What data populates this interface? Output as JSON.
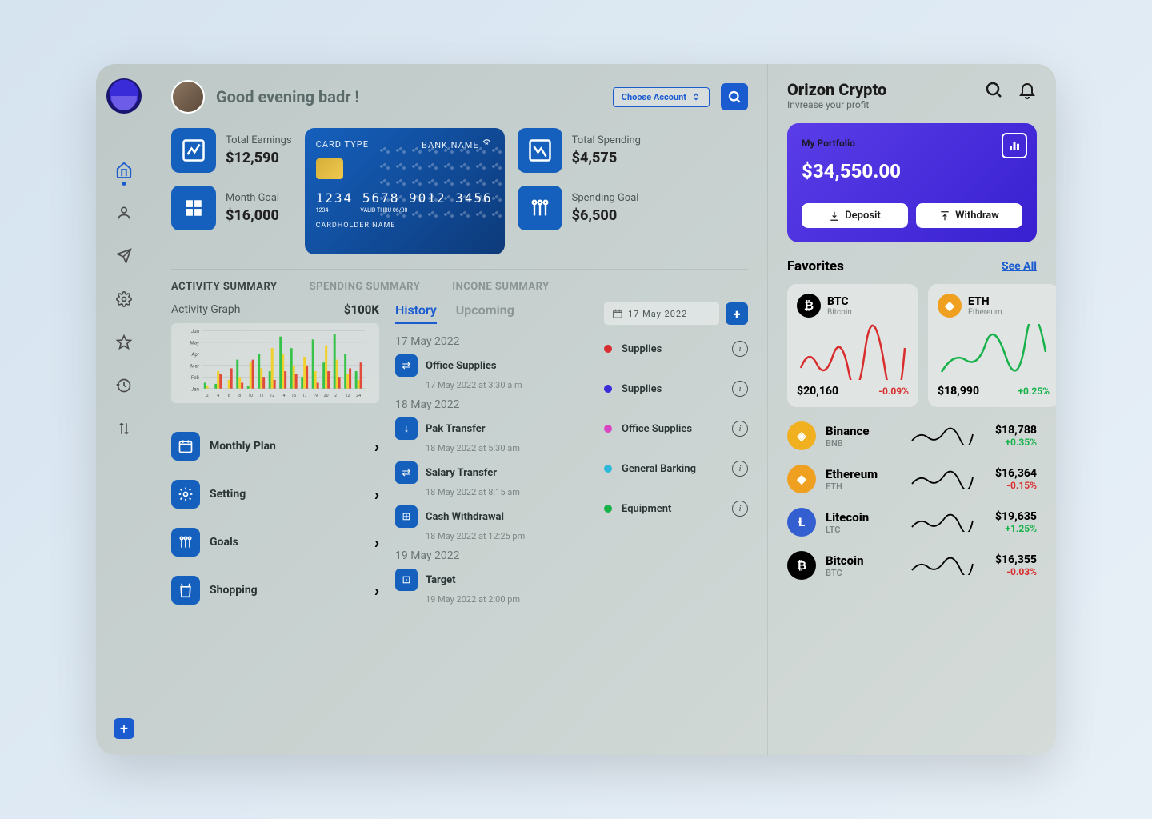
{
  "greeting": "Good evening badr !",
  "account_selector": "Choose Account",
  "stats": {
    "total_earnings": {
      "label": "Total Earnings",
      "value": "$12,590"
    },
    "month_goal": {
      "label": "Month Goal",
      "value": "$16,000"
    },
    "total_spending": {
      "label": "Total Spending",
      "value": "$4,575"
    },
    "spending_goal": {
      "label": "Spending Goal",
      "value": "$6,500"
    }
  },
  "card": {
    "type": "CARD TYPE",
    "bank": "BANK NAME",
    "number": "1234 5678 9012 3456",
    "sub_number": "1234",
    "valid_label": "VALID THRU",
    "valid_value": "06/30",
    "holder": "CARDHOLDER NAME"
  },
  "tabs": {
    "activity": "ACTIVITY SUMMARY",
    "spending": "SPENDING SUMMARY",
    "income": "INCONE SUMMARY"
  },
  "activity": {
    "title": "Activity Graph",
    "amount": "$100K",
    "quick_links": [
      {
        "label": "Monthly Plan"
      },
      {
        "label": "Setting"
      },
      {
        "label": "Goals"
      },
      {
        "label": "Shopping"
      }
    ]
  },
  "history_tabs": {
    "history": "History",
    "upcoming": "Upcoming"
  },
  "history": [
    {
      "date": "17 May 2022",
      "items": [
        {
          "label": "Office Supplies",
          "time": "17 May 2022 at 3:30 a m"
        }
      ]
    },
    {
      "date": "18 May 2022",
      "items": [
        {
          "label": "Pak Transfer",
          "time": "18 May 2022 at 5:30 am"
        },
        {
          "label": "Salary Transfer",
          "time": "18 May 2022 at 8:15 am"
        },
        {
          "label": "Cash Withdrawal",
          "time": "18 May 2022 at 12:25 pm"
        }
      ]
    },
    {
      "date": "19 May 2022",
      "items": [
        {
          "label": "Target",
          "time": "19 May 2022 at 2:00 pm"
        }
      ]
    }
  ],
  "date_selected": "17 May 2022",
  "categories": [
    {
      "label": "Supplies",
      "color": "#d92d2d"
    },
    {
      "label": "Supplies",
      "color": "#3a2bd8"
    },
    {
      "label": "Office Supplies",
      "color": "#d846c4"
    },
    {
      "label": "General Barking",
      "color": "#2db8d9"
    },
    {
      "label": "Equipment",
      "color": "#18b24b"
    }
  ],
  "brand": {
    "title": "Orizon Crypto",
    "subtitle": "Invrease your profit"
  },
  "portfolio": {
    "label": "My Portfolio",
    "value": "$34,550.00",
    "deposit": "Deposit",
    "withdraw": "Withdraw"
  },
  "favorites": {
    "title": "Favorites",
    "see_all": "See All",
    "cards": [
      {
        "symbol": "BTC",
        "name": "Bitcoin",
        "price": "$20,160",
        "change": "-0.09%",
        "positive": false,
        "color": "#000"
      },
      {
        "symbol": "ETH",
        "name": "Ethereum",
        "price": "$18,990",
        "change": "+0.25%",
        "positive": true,
        "color": "#f0a020"
      }
    ]
  },
  "coin_list": [
    {
      "name": "Binance",
      "symbol": "BNB",
      "price": "$18,788",
      "change": "+0.35%",
      "positive": true,
      "color": "#f0b020"
    },
    {
      "name": "Ethereum",
      "symbol": "ETH",
      "price": "$16,364",
      "change": "-0.15%",
      "positive": false,
      "color": "#f0a020"
    },
    {
      "name": "Litecoin",
      "symbol": "LTC",
      "price": "$19,635",
      "change": "+1.25%",
      "positive": true,
      "color": "#345fd0"
    },
    {
      "name": "Bitcoin",
      "symbol": "BTC",
      "price": "$16,355",
      "change": "-0.03%",
      "positive": false,
      "color": "#000"
    }
  ],
  "chart_data": {
    "type": "bar",
    "y_categories": [
      "Jan",
      "Feb",
      "Mar",
      "Apr",
      "May",
      "Jun"
    ],
    "x_ticks": [
      2,
      4,
      6,
      8,
      10,
      11,
      12,
      14,
      15,
      17,
      19,
      20,
      21,
      22,
      24
    ],
    "series": [
      {
        "name": "green",
        "color": "#37c24a",
        "values": [
          10,
          8,
          0,
          50,
          5,
          60,
          30,
          90,
          70,
          20,
          85,
          45,
          95,
          60,
          30
        ]
      },
      {
        "name": "yellow",
        "color": "#f2d02c",
        "values": [
          5,
          30,
          15,
          20,
          45,
          35,
          70,
          60,
          40,
          55,
          30,
          75,
          50,
          25,
          15
        ]
      },
      {
        "name": "red",
        "color": "#e04a3a",
        "values": [
          0,
          25,
          35,
          10,
          50,
          20,
          15,
          30,
          25,
          40,
          10,
          30,
          20,
          35,
          45
        ]
      }
    ]
  }
}
